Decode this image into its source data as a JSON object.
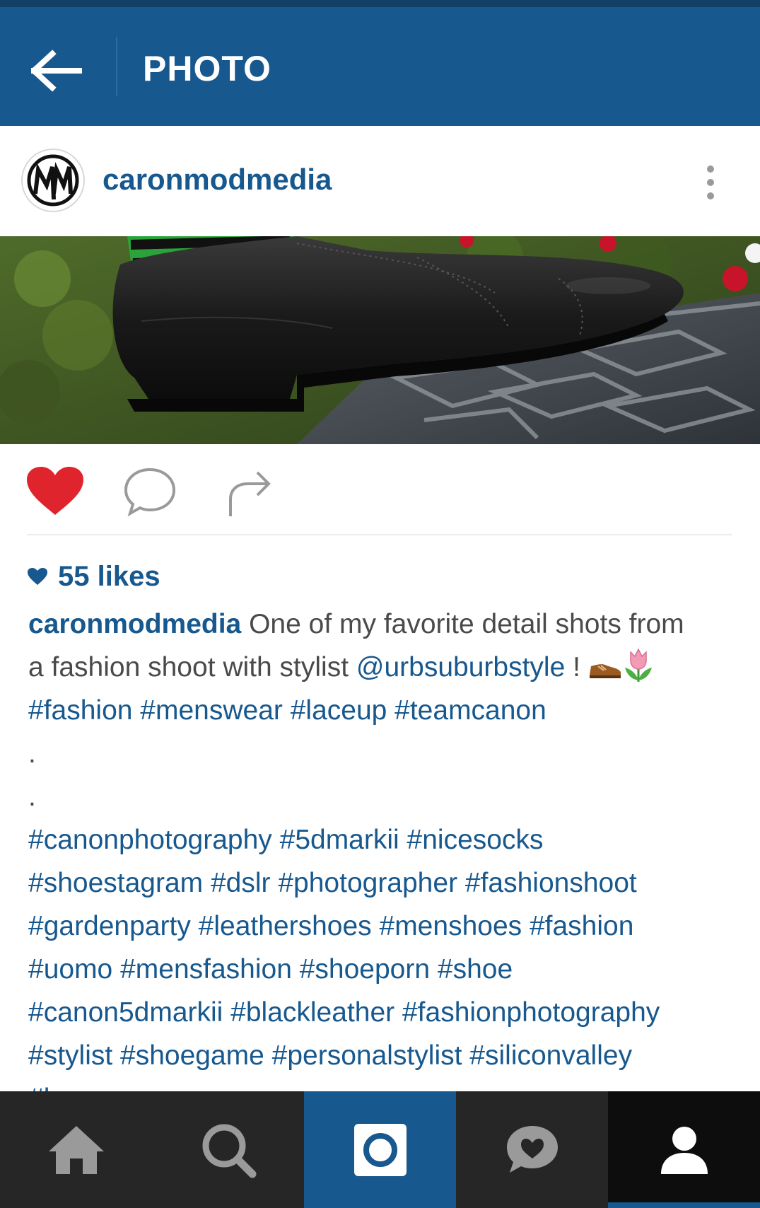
{
  "header": {
    "title": "PHOTO",
    "back_icon": "arrow-left-icon"
  },
  "post": {
    "username": "caronmodmedia",
    "avatar_icon": "mm-monogram-avatar",
    "more_icon": "more-vertical-icon"
  },
  "actions": {
    "like_icon": "heart-filled-icon",
    "comment_icon": "comment-bubble-icon",
    "share_icon": "share-arrow-icon"
  },
  "likes": {
    "text": "55 likes",
    "count": 55
  },
  "caption": {
    "username": "caronmodmedia",
    "line1_text": " One of my favorite detail shots from",
    "line2_text": "a fashion shoot with stylist ",
    "mention": "@urbsuburbstyle",
    "line2_suffix": " ! ",
    "emojis": [
      "shoe-emoji",
      "tulip-emoji"
    ],
    "line3": "#fashion #menswear #laceup #teamcanon",
    "dot1": ".",
    "dot2": ".",
    "tag_lines": [
      "#canonphotography #5dmarkii #nicesocks",
      "#shoestagram #dslr #photographer #fashionshoot",
      "#gardenparty #leathershoes #menshoes #fashion",
      "#uomo #mensfashion #shoeporn #shoe",
      "#canon5dmarkii #blackleather #fashionphotography",
      "#stylist #shoegame #personalstylist #siliconvalley",
      "#l"
    ]
  },
  "nav": {
    "items": [
      {
        "name": "home",
        "icon": "home-icon"
      },
      {
        "name": "search",
        "icon": "search-icon"
      },
      {
        "name": "camera",
        "icon": "camera-icon",
        "active": true
      },
      {
        "name": "activity",
        "icon": "activity-heart-icon"
      },
      {
        "name": "profile",
        "icon": "profile-icon"
      }
    ]
  },
  "colors": {
    "brand": "#17588e",
    "like_red": "#e0242e",
    "nav_bg": "#262626"
  }
}
